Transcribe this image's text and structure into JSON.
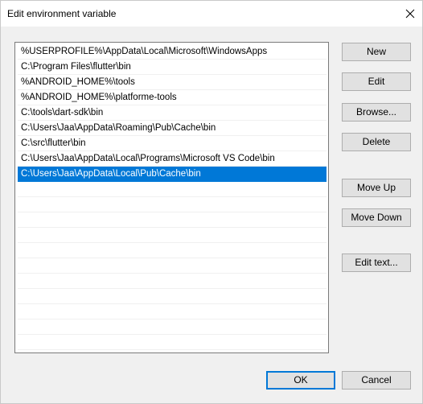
{
  "window": {
    "title": "Edit environment variable"
  },
  "paths": [
    {
      "value": "%USERPROFILE%\\AppData\\Local\\Microsoft\\WindowsApps",
      "selected": false
    },
    {
      "value": "C:\\Program Files\\flutter\\bin",
      "selected": false
    },
    {
      "value": "%ANDROID_HOME%\\tools",
      "selected": false
    },
    {
      "value": "%ANDROID_HOME%\\platforme-tools",
      "selected": false
    },
    {
      "value": "C:\\tools\\dart-sdk\\bin",
      "selected": false
    },
    {
      "value": "C:\\Users\\Jaa\\AppData\\Roaming\\Pub\\Cache\\bin",
      "selected": false
    },
    {
      "value": "C:\\src\\flutter\\bin",
      "selected": false
    },
    {
      "value": "C:\\Users\\Jaa\\AppData\\Local\\Programs\\Microsoft VS Code\\bin",
      "selected": false
    },
    {
      "value": "C:\\Users\\Jaa\\AppData\\Local\\Pub\\Cache\\bin",
      "selected": true
    },
    {
      "value": "",
      "selected": false
    },
    {
      "value": "",
      "selected": false
    },
    {
      "value": "",
      "selected": false
    },
    {
      "value": "",
      "selected": false
    },
    {
      "value": "",
      "selected": false
    },
    {
      "value": "",
      "selected": false
    },
    {
      "value": "",
      "selected": false
    },
    {
      "value": "",
      "selected": false
    },
    {
      "value": "",
      "selected": false
    },
    {
      "value": "",
      "selected": false
    },
    {
      "value": "",
      "selected": false
    }
  ],
  "buttons": {
    "new": "New",
    "edit": "Edit",
    "browse": "Browse...",
    "delete": "Delete",
    "move_up": "Move Up",
    "move_down": "Move Down",
    "edit_text": "Edit text...",
    "ok": "OK",
    "cancel": "Cancel"
  },
  "colors": {
    "selection": "#0078d7",
    "dialog_background": "#f0f0f0",
    "button_face": "#e1e1e1"
  },
  "icons": {
    "close": "close-icon"
  }
}
